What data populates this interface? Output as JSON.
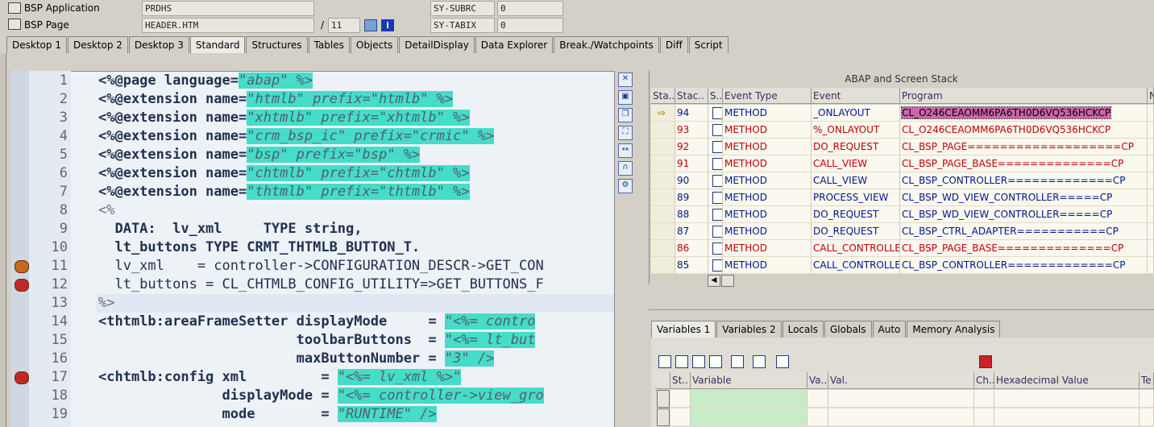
{
  "header": {
    "bsp_application_label": "BSP Application",
    "bsp_application_value": "PRDHS",
    "bsp_page_label": "BSP Page",
    "bsp_page_value": "HEADER.HTM",
    "page_slash": "/",
    "page_count": "11",
    "subrc_label": "SY-SUBRC",
    "subrc_value": "0",
    "tabix_label": "SY-TABIX",
    "tabix_value": "0"
  },
  "tabs": [
    {
      "label": "Desktop 1"
    },
    {
      "label": "Desktop 2"
    },
    {
      "label": "Desktop 3"
    },
    {
      "label": "Standard",
      "active": true
    },
    {
      "label": "Structures"
    },
    {
      "label": "Tables"
    },
    {
      "label": "Objects"
    },
    {
      "label": "DetailDisplay"
    },
    {
      "label": "Data Explorer"
    },
    {
      "label": "Break./Watchpoints"
    },
    {
      "label": "Diff"
    },
    {
      "label": "Script"
    }
  ],
  "editor": {
    "lines": [
      {
        "n": "1",
        "parts": [
          {
            "t": "<%@page language=",
            "c": "k"
          },
          {
            "t": "\"abap\" %>",
            "c": "s"
          }
        ]
      },
      {
        "n": "2",
        "parts": [
          {
            "t": "<%@extension name=",
            "c": "k"
          },
          {
            "t": "\"htmlb\" prefix=\"htmlb\" %>",
            "c": "s"
          }
        ]
      },
      {
        "n": "3",
        "parts": [
          {
            "t": "<%@extension name=",
            "c": "k"
          },
          {
            "t": "\"xhtmlb\" prefix=\"xhtmlb\" %>",
            "c": "s"
          }
        ]
      },
      {
        "n": "4",
        "parts": [
          {
            "t": "<%@extension name=",
            "c": "k"
          },
          {
            "t": "\"crm_bsp_ic\" prefix=\"crmic\" %>",
            "c": "s"
          }
        ]
      },
      {
        "n": "5",
        "parts": [
          {
            "t": "<%@extension name=",
            "c": "k"
          },
          {
            "t": "\"bsp\" prefix=\"bsp\" %>",
            "c": "s"
          }
        ]
      },
      {
        "n": "6",
        "parts": [
          {
            "t": "<%@extension name=",
            "c": "k"
          },
          {
            "t": "\"chtmlb\" prefix=\"chtmlb\" %>",
            "c": "s"
          }
        ]
      },
      {
        "n": "7",
        "parts": [
          {
            "t": "<%@extension name=",
            "c": "k"
          },
          {
            "t": "\"thtmlb\" prefix=\"thtmlb\" %>",
            "c": "s"
          }
        ]
      },
      {
        "n": "8",
        "parts": [
          {
            "t": "<%",
            "c": "p"
          }
        ]
      },
      {
        "n": "9",
        "parts": [
          {
            "t": "  DATA:  lv_xml     TYPE string,",
            "c": "k"
          }
        ]
      },
      {
        "n": "10",
        "parts": [
          {
            "t": "  lt_buttons TYPE CRMT_THTMLB_BUTTON_T.",
            "c": "k"
          }
        ]
      },
      {
        "n": "11",
        "parts": [
          {
            "t": "  lv_xml    = controller->CONFIGURATION_DESCR->GET_CON",
            "c": ""
          }
        ]
      },
      {
        "n": "12",
        "parts": [
          {
            "t": "  lt_buttons = CL_CHTMLB_CONFIG_UTILITY=>GET_BUTTONS_F",
            "c": ""
          }
        ]
      },
      {
        "n": "13",
        "parts": [
          {
            "t": "%>",
            "c": "p"
          }
        ]
      },
      {
        "n": "14",
        "parts": [
          {
            "t": "<thtmlb:areaFrameSetter displayMode     = ",
            "c": "k"
          },
          {
            "t": "\"<%= contro",
            "c": "s"
          }
        ]
      },
      {
        "n": "15",
        "parts": [
          {
            "t": "                        toolbarButtons  = ",
            "c": "k"
          },
          {
            "t": "\"<%= lt_but",
            "c": "s"
          }
        ]
      },
      {
        "n": "16",
        "parts": [
          {
            "t": "                        maxButtonNumber = ",
            "c": "k"
          },
          {
            "t": "\"3\" />",
            "c": "s"
          }
        ]
      },
      {
        "n": "17",
        "parts": [
          {
            "t": "<chtmlb:config xml         = ",
            "c": "k"
          },
          {
            "t": "\"<%= lv_xml %>\"",
            "c": "s"
          }
        ]
      },
      {
        "n": "18",
        "parts": [
          {
            "t": "               displayMode = ",
            "c": "k"
          },
          {
            "t": "\"<%= controller->view_gro",
            "c": "s"
          }
        ]
      },
      {
        "n": "19",
        "parts": [
          {
            "t": "               mode        = ",
            "c": "k"
          },
          {
            "t": "\"RUNTIME\" />",
            "c": "s"
          }
        ]
      }
    ]
  },
  "stack": {
    "title": "ABAP and Screen Stack",
    "columns": [
      "Sta..",
      "Stac..",
      "S..",
      "Event Type",
      "Event",
      "Program",
      "N"
    ],
    "rows": [
      {
        "level": "94",
        "type": "METHOD",
        "event": "_ONLAYOUT",
        "program": "CL_O246CEAOMM6PA6TH0D6VQ536HCKCP",
        "color": "blue",
        "current": true
      },
      {
        "level": "93",
        "type": "METHOD",
        "event": "%_ONLAYOUT",
        "program": "CL_O246CEAOMM6PA6TH0D6VQ536HCKCP",
        "color": "red"
      },
      {
        "level": "92",
        "type": "METHOD",
        "event": "DO_REQUEST",
        "program": "CL_BSP_PAGE===================CP",
        "color": "red"
      },
      {
        "level": "91",
        "type": "METHOD",
        "event": "CALL_VIEW",
        "program": "CL_BSP_PAGE_BASE==============CP",
        "color": "red"
      },
      {
        "level": "90",
        "type": "METHOD",
        "event": "CALL_VIEW",
        "program": "CL_BSP_CONTROLLER=============CP",
        "color": "blue"
      },
      {
        "level": "89",
        "type": "METHOD",
        "event": "PROCESS_VIEW",
        "program": "CL_BSP_WD_VIEW_CONTROLLER=====CP",
        "color": "blue"
      },
      {
        "level": "88",
        "type": "METHOD",
        "event": "DO_REQUEST",
        "program": "CL_BSP_WD_VIEW_CONTROLLER=====CP",
        "color": "blue"
      },
      {
        "level": "87",
        "type": "METHOD",
        "event": "DO_REQUEST",
        "program": "CL_BSP_CTRL_ADAPTER===========CP",
        "color": "blue"
      },
      {
        "level": "86",
        "type": "METHOD",
        "event": "CALL_CONTROLLER",
        "program": "CL_BSP_PAGE_BASE==============CP",
        "color": "red"
      },
      {
        "level": "85",
        "type": "METHOD",
        "event": "CALL_CONTROLLER",
        "program": "CL_BSP_CONTROLLER=============CP",
        "color": "blue"
      }
    ]
  },
  "var_tabs": [
    {
      "label": "Variables 1",
      "active": true
    },
    {
      "label": "Variables 2"
    },
    {
      "label": "Locals"
    },
    {
      "label": "Globals"
    },
    {
      "label": "Auto"
    },
    {
      "label": "Memory Analysis"
    }
  ],
  "var_table": {
    "columns": [
      "St..",
      "Variable",
      "Va..",
      "Val.",
      "Ch..",
      "Hexadecimal Value",
      "Te"
    ]
  }
}
